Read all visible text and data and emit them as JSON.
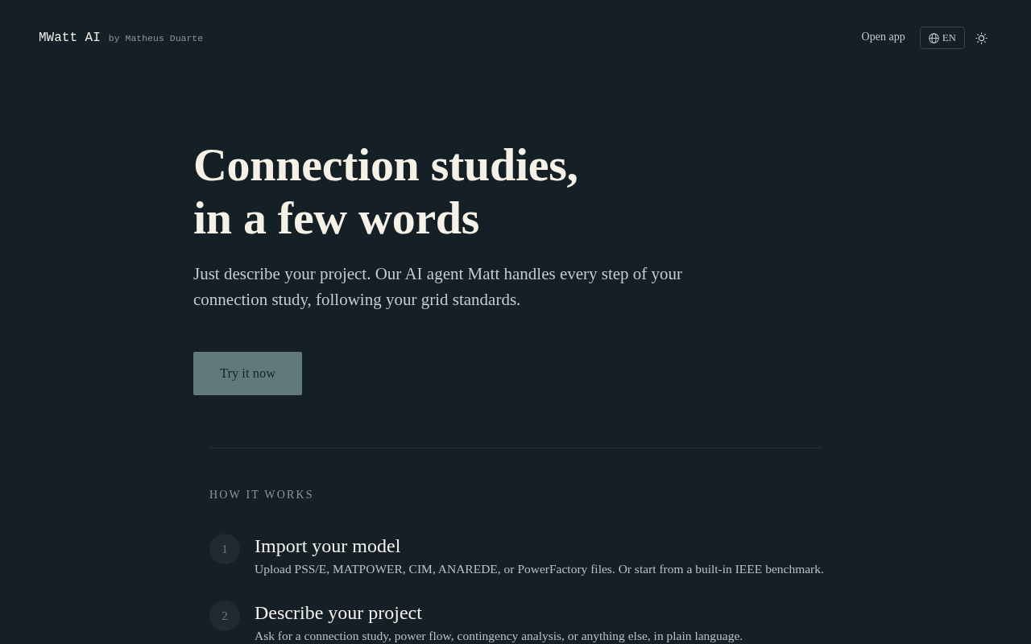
{
  "header": {
    "brand": "MWatt AI",
    "byline": "by Matheus Duarte",
    "nav_link": "Open app",
    "language_button": "EN"
  },
  "hero": {
    "title_lines": [
      "Connection studies,",
      "in a few words"
    ],
    "subtitle": "Just describe your project. Our AI agent Matt handles every step of your connection study, following your grid standards.",
    "cta": "Try it now"
  },
  "how_it_works": {
    "heading": "HOW IT WORKS",
    "steps": [
      {
        "number": "1",
        "title": "Import your model",
        "description": "Upload PSS/E, MATPOWER, CIM, ANAREDE, or PowerFactory files. Or start from a built-in IEEE benchmark."
      },
      {
        "number": "2",
        "title": "Describe your project",
        "description": "Ask for a connection study, power flow, contingency analysis, or anything else, in plain language."
      }
    ]
  }
}
